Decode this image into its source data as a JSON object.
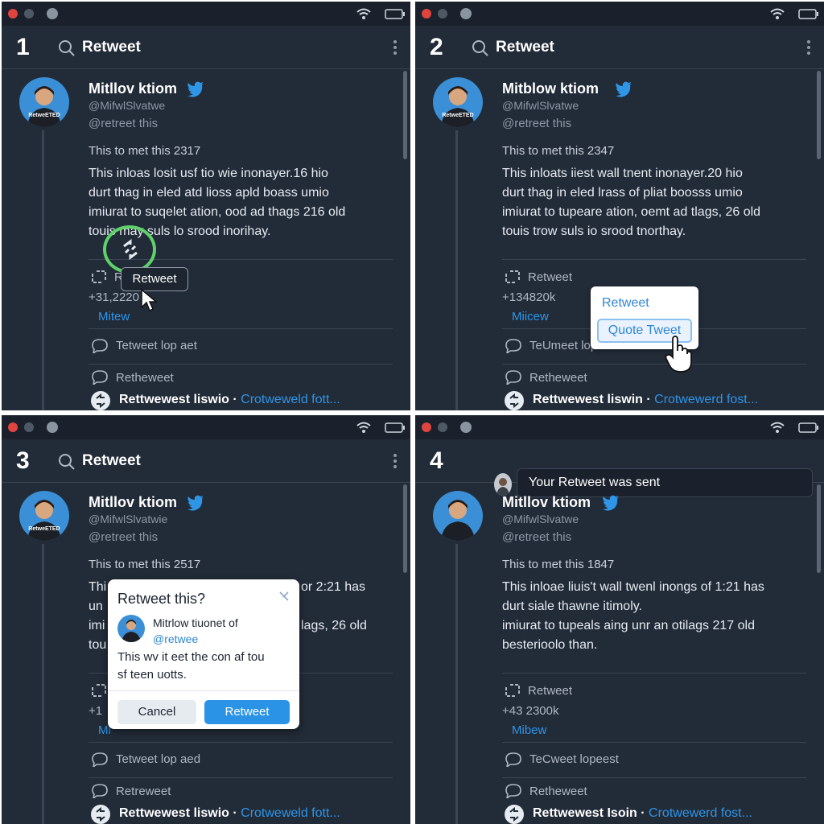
{
  "panels": [
    {
      "step": "1",
      "header_title": "Retweet",
      "author_name": "Mitllov ktiom",
      "handle": "@MifwlSlvatwe",
      "subhandle": "@retreet this",
      "meta": "This to met this 2317",
      "body": [
        "This inloas losit usf tio wie inonayer.16 hio",
        "durt thag in eled atd lioss apld boass umio",
        "imiurat to suqelet ation, ood ad thags 216 old",
        "touis may suls lo srood inorihay."
      ],
      "retweet_label": "R",
      "count": "+31,2220",
      "view_link": "Mitew",
      "row1": "Tetweet lop aet",
      "row2": "Retheweet",
      "footer_bold": "Rettwewest liswio",
      "footer_link": "Crotweweld fott..."
    },
    {
      "step": "2",
      "header_title": "Retweet",
      "author_name": "Mitblow ktiom",
      "handle": "@MifwlSlvatwe",
      "subhandle": "@retreet this",
      "meta": "This to met this 2347",
      "body": [
        "This inloats iiest wall tnent inonayer.20 hio",
        "durt thag in eled lrass of pliat boosss umio",
        "imiurat to tupeare ation, oemt ad tlags, 26 old",
        "touis trow suls io srood tnorthay."
      ],
      "retweet_label": "Retweet",
      "count": "+134820k",
      "view_link": "Miicew",
      "row1": "TeUmeet lop set",
      "row2": "Retheweet",
      "footer_bold": "Rettwewest liswin",
      "footer_link": "Crotwewerd fost..."
    },
    {
      "step": "3",
      "header_title": "Retweet",
      "author_name": "Mitllov ktiom",
      "handle": "@MifwlSlvatwie",
      "subhandle": "@retreet this",
      "meta": "This to met this 2517",
      "body": [
        "Thi",
        "un",
        "imi",
        "tou"
      ],
      "body_peek": [
        "or 2:21 has",
        "lags, 26 old"
      ],
      "retweet_label": "",
      "count": "+1",
      "view_link": "Mi",
      "row1": "Tetweet lop aed",
      "row2": "Retreweet",
      "footer_bold": "Rettwewest liswio",
      "footer_link": "Crotweweld fott..."
    },
    {
      "step": "4",
      "header_title": "Your Retweet was sent",
      "author_name": "Mitllov ktiom",
      "handle": "@MifwlSlvatwe",
      "subhandle": "@retreet this",
      "meta": "This to met this 1847",
      "body": [
        "This inloae liuis't wall twenl inongs of 1:21 has",
        "durt siale thawne itimoly.",
        "imiurat to tupeals aing unr an otilags 217 old",
        "besterioolo than."
      ],
      "retweet_label": "Retweet",
      "count": "+43 2300k",
      "view_link": "Mibew",
      "row1": "TeCweet lopeest",
      "row2": "Retheweet",
      "footer_bold": "Rettwewest Isoin",
      "footer_link": "Crotwewerd fost..."
    }
  ],
  "avatar_caption": "RetweETED",
  "tooltip": "Retweet",
  "menu": {
    "item_retweet": "Retweet",
    "item_quote": "Quote Tweet"
  },
  "dialog": {
    "title": "Retweet this?",
    "user": "Mitrlow tiuonet of",
    "handle": "@retwee",
    "text_line1": "This wv it eet the con af tou",
    "text_line2": "sf teen uotts.",
    "cancel": "Cancel",
    "confirm": "Retweet"
  },
  "colors": {
    "background": "#222b38",
    "titlebar": "#1a212c",
    "accent": "#2f95e6",
    "click_ring": "#5fd16a"
  }
}
